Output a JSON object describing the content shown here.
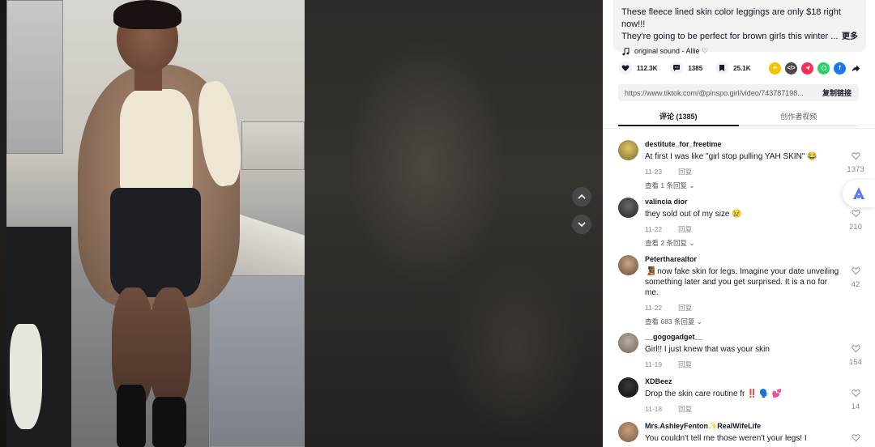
{
  "video": {
    "nav_up_icon": "chevron-up-icon",
    "nav_down_icon": "chevron-down-icon"
  },
  "description": {
    "line1": "These fleece lined skin color leggings are only $18 right now!!!",
    "line2": "They're going to be perfect for brown girls this winter ...",
    "more_label": "更多",
    "sound_label": "original sound - Allie ♡"
  },
  "stats": {
    "likes": "112.3K",
    "comments": "1385",
    "saves": "25.1K"
  },
  "share": {
    "icons": [
      "tiktok-friends-icon",
      "embed-icon",
      "send-icon",
      "whatsapp-icon",
      "facebook-icon",
      "share-arrow-icon"
    ],
    "colors": [
      "#f5c400",
      "#4a4a4a",
      "#fe2c55",
      "#25d366",
      "#1877f2",
      "#161823"
    ]
  },
  "link": {
    "url": "https://www.tiktok.com/@pinspo.girl/video/743787198...",
    "copy_label": "复制链接"
  },
  "tabs": {
    "comments_label": "评论 (1385)",
    "creator_label": "创作者视频"
  },
  "comments": [
    {
      "user": "destitute_for_freetime",
      "text": "At first I was like \"girl stop pulling YAH SKIN\" 😂",
      "date": "11-23",
      "reply": "回复",
      "replies": "查看 1 条回复 ⌄",
      "likes": "1373"
    },
    {
      "user": "valincia dior",
      "text": "they sold out of my size 😢",
      "date": "11-22",
      "reply": "回复",
      "replies": "查看 2 条回复 ⌄",
      "likes": "210"
    },
    {
      "user": "Petertharealtor",
      "text": "🧏🏾 now fake skin for legs. Imagine your date unveiling something later and you get surprised. It is a no for me.",
      "date": "11-22",
      "reply": "回复",
      "replies": "查看 683 条回复 ⌄",
      "likes": "42"
    },
    {
      "user": "__gogogadget__",
      "text": "Girl!! I just knew that was your skin",
      "date": "11-19",
      "reply": "回复",
      "likes": "154"
    },
    {
      "user": "XDBeez",
      "text": "Drop the skin care routine fr ‼️ 🗣️ 💕",
      "date": "11-18",
      "reply": "回复",
      "likes": "14"
    },
    {
      "user": "Mrs.AshleyFenton✨RealWifeLife",
      "text": "You couldn't tell me those weren't your legs! I",
      "likes": ""
    }
  ],
  "colors": {
    "accent_red": "#fe2c55",
    "text_primary": "#161823",
    "text_secondary": "#8a8b91"
  }
}
